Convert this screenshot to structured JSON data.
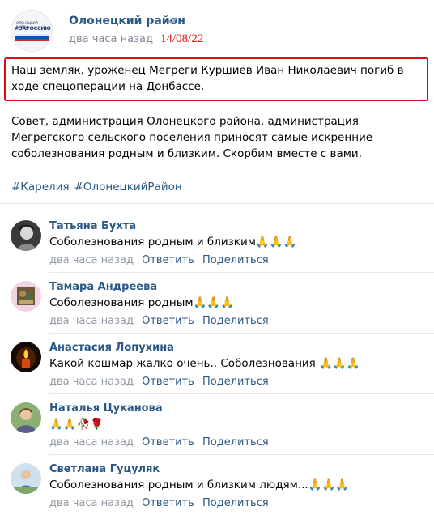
{
  "post": {
    "avatar_logo": {
      "line1": "ОЛОНЕЦКИЙ РАЙОН",
      "line2": "#ЗАРОССИЮ"
    },
    "author": "Олонецкий район",
    "verified_icon": "checkmark-icon",
    "time": "два часа назад",
    "date_stamp": "14/08/22",
    "highlight_color": "#dd0b16",
    "lead_text": "Наш земляк, уроженец Мегреги Куршиев Иван Николаевич погиб в ходе спецоперации на Донбассе.",
    "body_text": "Совет, администрация Олонецкого района, администрация Мегрегского сельского поселения приносят самые искренние соболезнования родным и близким. Скорбим вместе с вами.",
    "hashtags": [
      "#Карелия",
      "#ОлонецкийРайон"
    ]
  },
  "colors": {
    "link": "#2a5885",
    "meta": "#939ca6",
    "stamp_red": "#e01010"
  },
  "comments": [
    {
      "author": "Татьяна Бухта",
      "text": "Соболезнования родным и близким🙏🙏🙏",
      "time": "два часа назад",
      "reply": "Ответить",
      "share": "Поделиться"
    },
    {
      "author": "Тамара Андреева",
      "text": "Соболезнования родным🙏🙏🙏",
      "time": "два часа назад",
      "reply": "Ответить",
      "share": "Поделиться"
    },
    {
      "author": "Анастасия Лопухина",
      "text": "Какой кошмар жалко очень.. Соболезнования 🙏🙏🙏",
      "time": "два часа назад",
      "reply": "Ответить",
      "share": "Поделиться"
    },
    {
      "author": "Наталья Цуканова",
      "text": "🙏🙏🥀🌹",
      "time": "два часа назад",
      "reply": "Ответить",
      "share": "Поделиться"
    },
    {
      "author": "Светлана Гуцуляк",
      "text": "Соболезнования родным и близким людям...🙏🙏🙏",
      "time": "два часа назад",
      "reply": "Ответить",
      "share": "Поделиться"
    }
  ]
}
